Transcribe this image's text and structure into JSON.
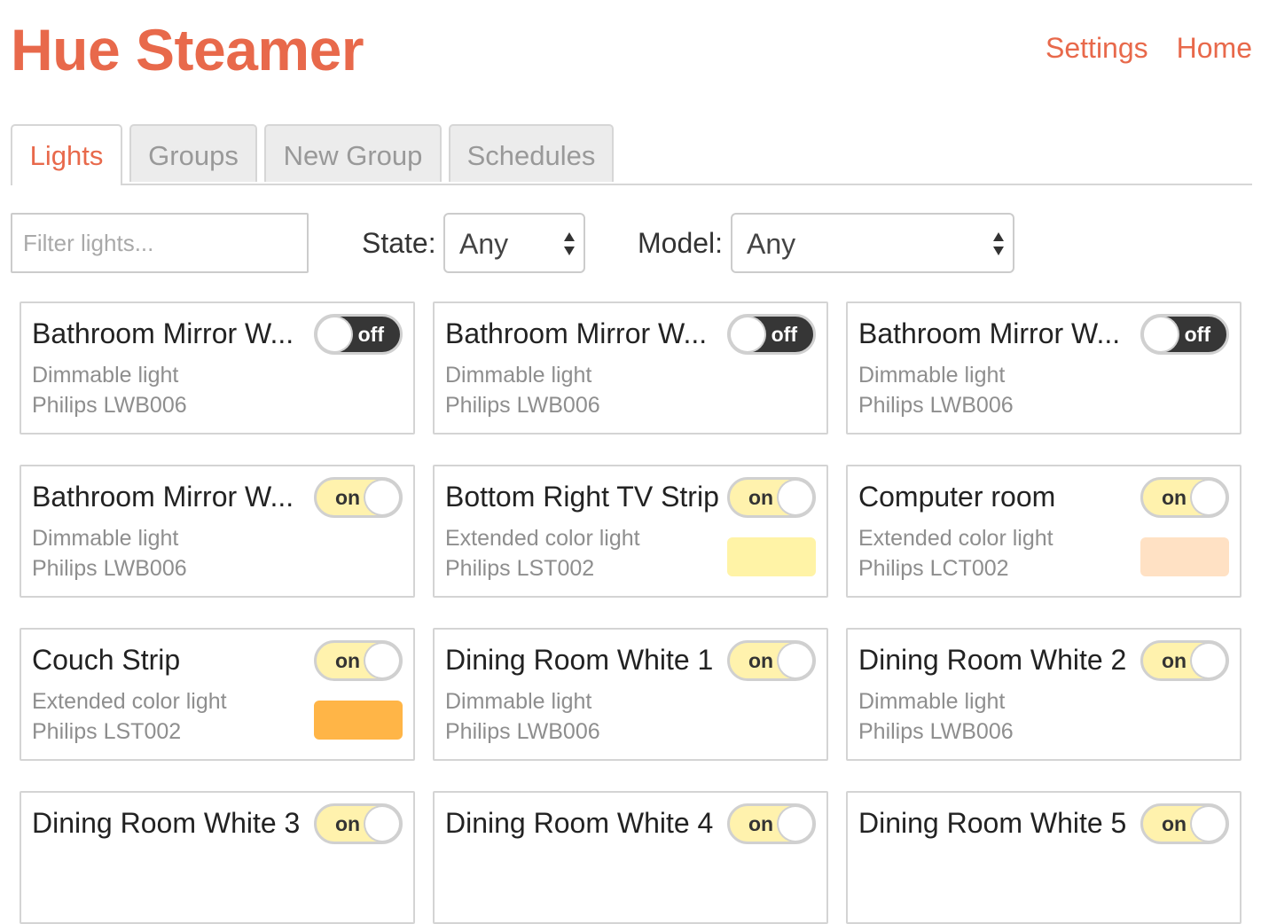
{
  "header": {
    "title": "Hue Steamer",
    "nav": [
      "Settings",
      "Home"
    ]
  },
  "tabs": [
    "Lights",
    "Groups",
    "New Group",
    "Schedules"
  ],
  "active_tab": "Lights",
  "filters": {
    "search_placeholder": "Filter lights...",
    "state_label": "State:",
    "state_value": "Any",
    "model_label": "Model:",
    "model_value": "Any"
  },
  "lights": [
    {
      "name": "Bathroom Mirror W...",
      "type": "Dimmable light",
      "model": "Philips LWB006",
      "state": "off",
      "color": null
    },
    {
      "name": "Bathroom Mirror W...",
      "type": "Dimmable light",
      "model": "Philips LWB006",
      "state": "off",
      "color": null
    },
    {
      "name": "Bathroom Mirror W...",
      "type": "Dimmable light",
      "model": "Philips LWB006",
      "state": "off",
      "color": null
    },
    {
      "name": "Bathroom Mirror W...",
      "type": "Dimmable light",
      "model": "Philips LWB006",
      "state": "on",
      "color": null
    },
    {
      "name": "Bottom Right TV Strip",
      "type": "Extended color light",
      "model": "Philips LST002",
      "state": "on",
      "color": "#fff3a6"
    },
    {
      "name": "Computer room",
      "type": "Extended color light",
      "model": "Philips LCT002",
      "state": "on",
      "color": "#ffe1c4"
    },
    {
      "name": "Couch Strip",
      "type": "Extended color light",
      "model": "Philips LST002",
      "state": "on",
      "color": "#ffb547"
    },
    {
      "name": "Dining Room White 1",
      "type": "Dimmable light",
      "model": "Philips LWB006",
      "state": "on",
      "color": null
    },
    {
      "name": "Dining Room White 2",
      "type": "Dimmable light",
      "model": "Philips LWB006",
      "state": "on",
      "color": null
    },
    {
      "name": "Dining Room White 3",
      "type": "",
      "model": "",
      "state": "on",
      "color": null
    },
    {
      "name": "Dining Room White 4",
      "type": "",
      "model": "",
      "state": "on",
      "color": null
    },
    {
      "name": "Dining Room White 5",
      "type": "",
      "model": "",
      "state": "on",
      "color": null
    }
  ],
  "colors": {
    "accent": "#e8694b",
    "toggle_on": "#fff2ad",
    "toggle_off": "#363636"
  }
}
